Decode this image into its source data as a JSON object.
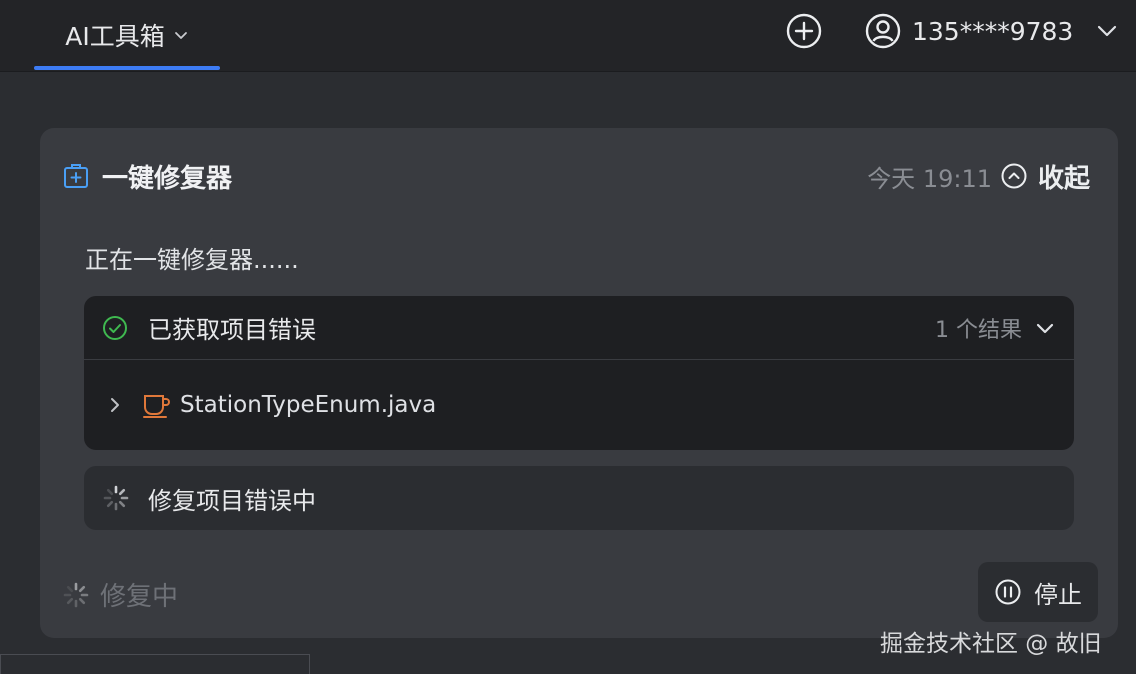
{
  "topbar": {
    "tab_label": "AI工具箱",
    "user_name": "135****9783",
    "accent": "#3d7cf5"
  },
  "card": {
    "title": "一键修复器",
    "time": "今天 19:11",
    "collapse_label": "收起",
    "status_text": "正在一键修复器......",
    "step1": {
      "title": "已获取项目错误",
      "result": "1 个结果",
      "file": "StationTypeEnum.java"
    },
    "step2": {
      "title": "修复项目错误中"
    },
    "footer_status": "修复中",
    "stop_label": "停止"
  },
  "watermark": "掘金技术社区 @ 故旧"
}
